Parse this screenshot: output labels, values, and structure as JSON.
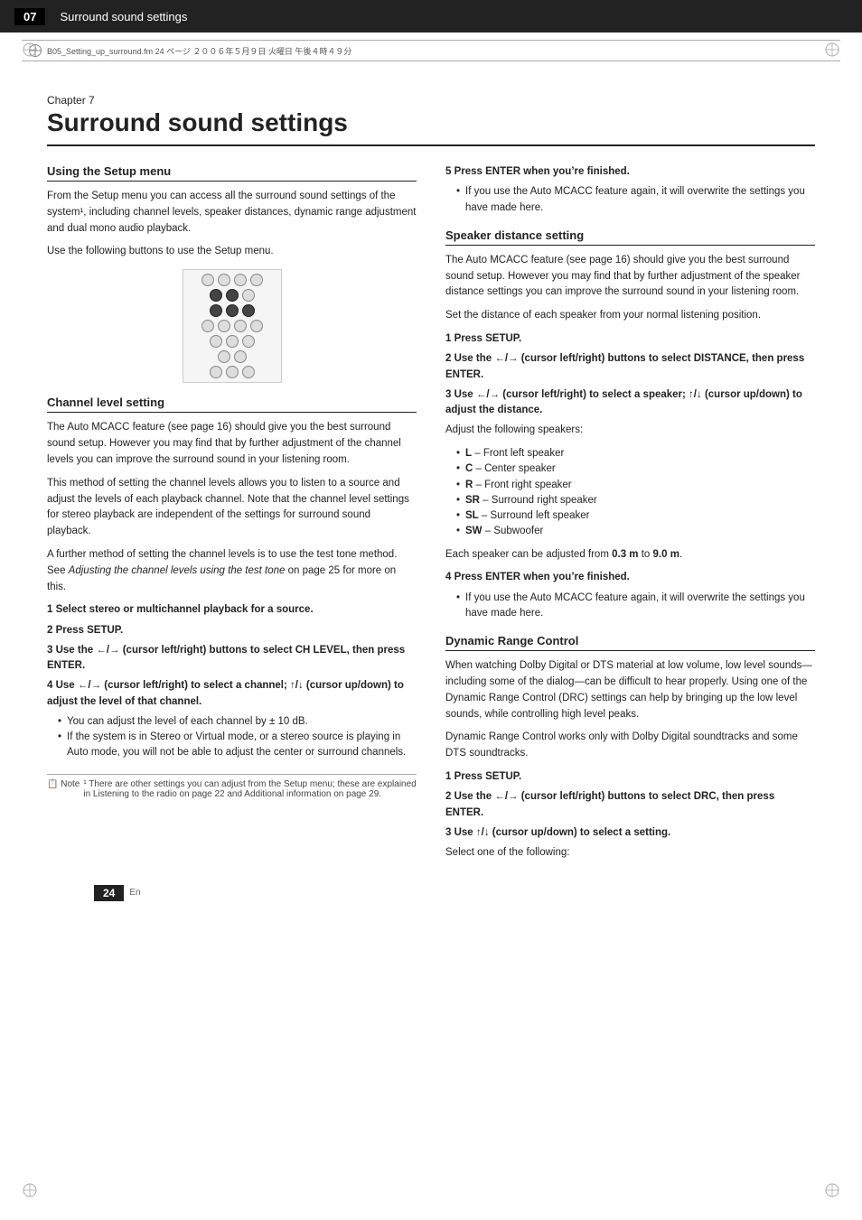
{
  "header": {
    "chapter_num": "07",
    "title": "Surround sound settings"
  },
  "print_header": {
    "text": "B05_Setting_up_surround.fm  24  ページ  ２００６年５月９日  火曜日  午後４時４９分"
  },
  "chapter": {
    "label": "Chapter 7",
    "title": "Surround sound settings"
  },
  "left_col": {
    "section1": {
      "heading": "Using the Setup menu",
      "para1": "From the Setup menu you can access all the surround sound settings of the system¹, including channel levels, speaker distances, dynamic range adjustment and dual mono audio playback.",
      "para2": "Use the following buttons to use the Setup menu.",
      "section2_heading": "Channel level setting",
      "section2_para1": "The Auto MCACC feature (see page 16) should give you the best surround sound setup. However you may find that by further adjustment of the channel levels you can improve the surround sound in your listening room.",
      "section2_para2": "This method of setting the channel levels allows you to listen to a source and adjust the levels of each playback channel. Note that the channel level settings for stereo playback are independent of the settings for surround sound playback.",
      "section2_para3": "A further method of setting the channel levels is to use the test tone method. See Adjusting the channel levels using the test tone on page 25 for more on this.",
      "step1": "1   Select stereo or multichannel playback for a source.",
      "step2": "2   Press SETUP.",
      "step3": "3   Use the ←/→ (cursor left/right) buttons to select CH LEVEL, then press ENTER.",
      "step4": "4   Use ←/→ (cursor left/right) to select a channel; ↑/↓ (cursor up/down) to adjust the level of that channel.",
      "step4_bullet1": "You can adjust the level of each channel by ± 10 dB.",
      "step4_bullet2": "If the system is in Stereo or Virtual mode, or a stereo source is playing in Auto mode, you will not be able to adjust the center or surround channels."
    }
  },
  "right_col": {
    "step5": "5   Press ENTER when you’re finished.",
    "step5_bullet1": "If you use the Auto MCACC feature again, it will overwrite the settings you have made here.",
    "section_speaker": {
      "heading": "Speaker distance setting",
      "para1": "The Auto MCACC feature (see page 16) should give you the best surround sound setup. However you may find that by further adjustment of the speaker distance settings you can improve the surround sound in your listening room.",
      "para2": "Set the distance of each speaker from your normal listening position.",
      "step1": "1   Press SETUP.",
      "step2": "2   Use the ←/→ (cursor left/right) buttons to select DISTANCE, then press ENTER.",
      "step3": "3   Use ←/→ (cursor left/right) to select a speaker; ↑/↓ (cursor up/down) to adjust the distance.",
      "step3_sub": "Adjust the following speakers:",
      "speakers": [
        "L – Front left speaker",
        "C – Center speaker",
        "R – Front right speaker",
        "SR – Surround right speaker",
        "SL – Surround left speaker",
        "SW – Subwoofer"
      ],
      "range_text": "Each speaker can be adjusted from 0.3 m to 9.0 m.",
      "step4": "4   Press ENTER when you’re finished.",
      "step4_bullet1": "If you use the Auto MCACC feature again, it will overwrite the settings you have made here."
    },
    "section_drc": {
      "heading": "Dynamic Range Control",
      "para1": "When watching Dolby Digital or DTS material at low volume, low level sounds—including some of the dialog—can be difficult to hear properly. Using one of the Dynamic Range Control (DRC) settings can help by bringing up the low level sounds, while controlling high level peaks.",
      "para2": "Dynamic Range Control works only with Dolby Digital soundtracks and some DTS soundtracks.",
      "step1": "1   Press SETUP.",
      "step2": "2   Use the ←/→ (cursor left/right) buttons to select DRC, then press ENTER.",
      "step3": "3   Use ↑/↓ (cursor up/down) to select a setting.",
      "step3_sub": "Select one of the following:"
    }
  },
  "note": {
    "icon": "📋 Note",
    "text": "¹ There are other settings you can adjust from the Setup menu; these are explained in Listening to the radio on page 22 and Additional information on page 29."
  },
  "footer": {
    "page_number": "24",
    "sub": "En"
  }
}
